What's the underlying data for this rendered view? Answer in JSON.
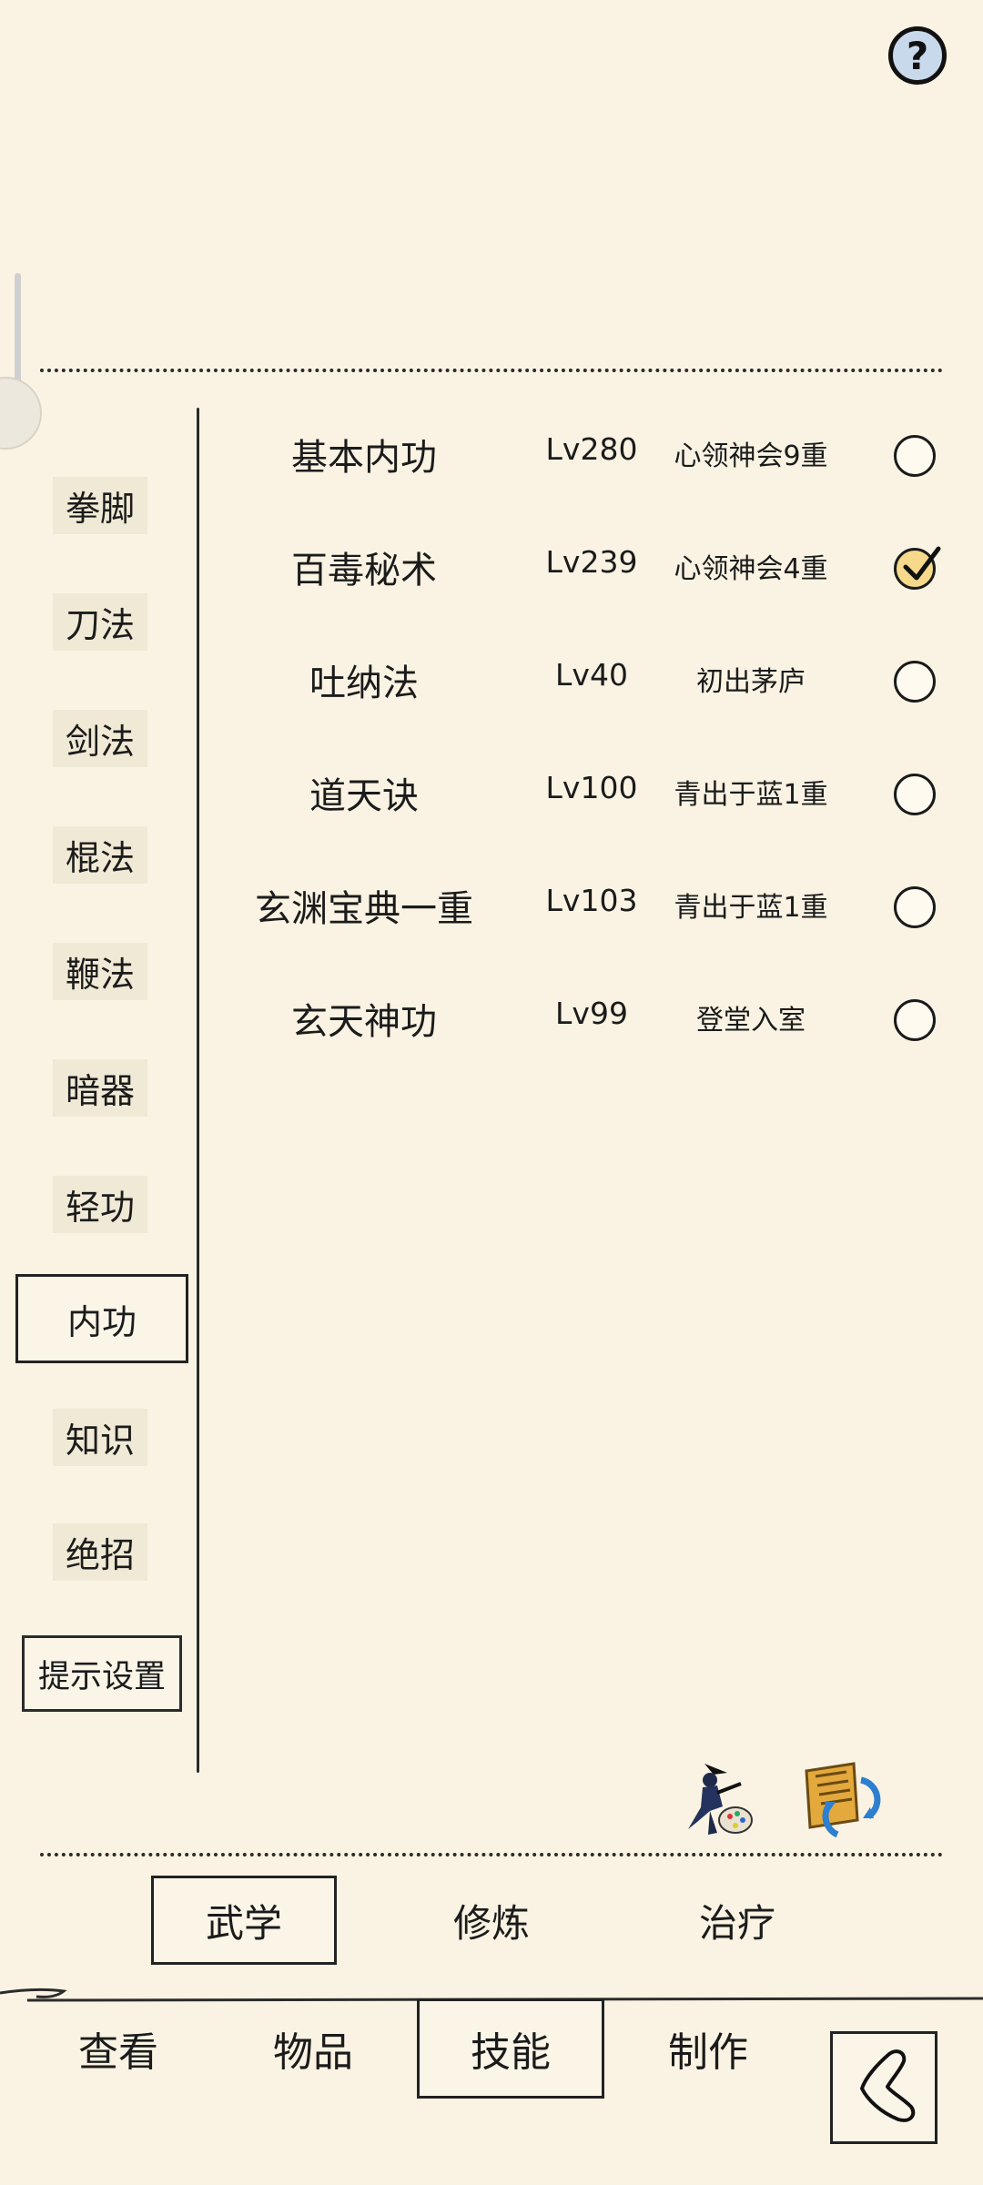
{
  "help": {
    "label": "?"
  },
  "sidebar": {
    "items": [
      {
        "label": "拳脚"
      },
      {
        "label": "刀法"
      },
      {
        "label": "剑法"
      },
      {
        "label": "棍法"
      },
      {
        "label": "鞭法"
      },
      {
        "label": "暗器"
      },
      {
        "label": "轻功"
      },
      {
        "label": "内功"
      },
      {
        "label": "知识"
      },
      {
        "label": "绝招"
      }
    ],
    "active": "内功",
    "hint_settings_label": "提示设置"
  },
  "skills": [
    {
      "name": "基本内功",
      "level": "Lv280",
      "rank": "心领神会9重",
      "checked": false
    },
    {
      "name": "百毒秘术",
      "level": "Lv239",
      "rank": "心领神会4重",
      "checked": true
    },
    {
      "name": "吐纳法",
      "level": "Lv40",
      "rank": "初出茅庐",
      "checked": false
    },
    {
      "name": "道天诀",
      "level": "Lv100",
      "rank": "青出于蓝1重",
      "checked": false
    },
    {
      "name": "玄渊宝典一重",
      "level": "Lv103",
      "rank": "青出于蓝1重",
      "checked": false
    },
    {
      "name": "玄天神功",
      "level": "Lv99",
      "rank": "登堂入室",
      "checked": false
    }
  ],
  "sub_tabs": [
    {
      "label": "武学",
      "active": true
    },
    {
      "label": "修炼",
      "active": false
    },
    {
      "label": "治疗",
      "active": false
    }
  ],
  "bottom_nav": [
    {
      "label": "查看",
      "active": false
    },
    {
      "label": "物品",
      "active": false
    },
    {
      "label": "技能",
      "active": true
    },
    {
      "label": "制作",
      "active": false
    }
  ],
  "icons": {
    "help": "question-icon",
    "back": "back-arrow-icon",
    "martial": "warrior-palette-icon",
    "swap": "book-swap-icon"
  }
}
